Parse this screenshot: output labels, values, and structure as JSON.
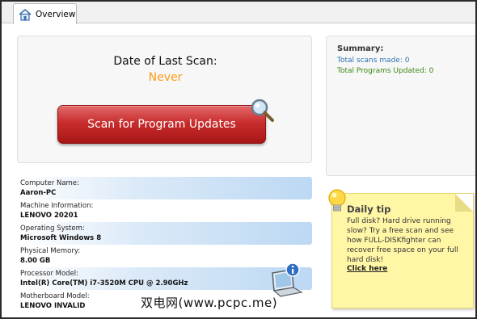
{
  "tabs": [
    {
      "label": "Overview",
      "icon": "home-icon",
      "active": true
    }
  ],
  "scan": {
    "date_title": "Date of Last Scan:",
    "date_value": "Never",
    "date_value_color": "#ff9a16",
    "button_label": "Scan for Program Updates",
    "button_color": "#c92d2d"
  },
  "summary": {
    "title": "Summary:",
    "total_scans": "Total scans made: 0",
    "total_updated": "Total Programs Updated: 0"
  },
  "system_info": [
    {
      "label": "Computer Name:",
      "value": "Aaron-PC"
    },
    {
      "label": "Machine Information:",
      "value": "LENOVO 20201"
    },
    {
      "label": "Operating System:",
      "value": "Microsoft Windows 8"
    },
    {
      "label": "Physical Memory:",
      "value": "8.00 GB"
    },
    {
      "label": "Processor Model:",
      "value": "Intel(R) Core(TM) i7-3520M CPU @ 2.90GHz"
    },
    {
      "label": "Motherboard Model:",
      "value": "LENOVO INVALID"
    }
  ],
  "daily_tip": {
    "title": "Daily tip",
    "body": "Full disk? Hard drive running slow?   Try a free scan and see how FULL-DISKfighter can recover free space on your full hard disk!",
    "link": "Click here"
  },
  "watermark": "双电网(www.pcpc.me)"
}
